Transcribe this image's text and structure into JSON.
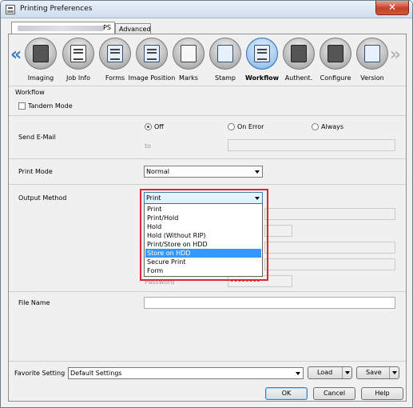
{
  "window": {
    "title": "Printing Preferences",
    "close_symbol": "✕"
  },
  "tabs": {
    "active_label": "PS",
    "inactive_label": "Advanced"
  },
  "iconbar": {
    "items": [
      {
        "label": "Imaging",
        "icon": "imaging-icon"
      },
      {
        "label": "Job Info",
        "icon": "job-info-icon"
      },
      {
        "label": "Forms",
        "icon": "forms-icon"
      },
      {
        "label": "Image Position",
        "icon": "image-position-icon"
      },
      {
        "label": "Marks",
        "icon": "marks-icon"
      },
      {
        "label": "Stamp",
        "icon": "stamp-icon"
      },
      {
        "label": "Workflow",
        "icon": "workflow-icon",
        "active": true
      },
      {
        "label": "Authent.",
        "icon": "authentication-icon"
      },
      {
        "label": "Configure",
        "icon": "configure-icon"
      },
      {
        "label": "Version",
        "icon": "version-icon"
      }
    ],
    "left_arrow": "«",
    "right_arrow": "»"
  },
  "workflow": {
    "section_label": "Workflow",
    "tandem_mode_label": "Tandem Mode",
    "send_email": {
      "label": "Send E-Mail",
      "options": [
        "Off",
        "On Error",
        "Always"
      ],
      "selected": "Off",
      "to_label": "to"
    },
    "print_mode": {
      "label": "Print Mode",
      "value": "Normal"
    },
    "output_method": {
      "label": "Output Method",
      "value": "Print",
      "options": [
        "Print",
        "Print/Hold",
        "Hold",
        "Hold (Without RIP)",
        "Print/Store on HDD",
        "Store on HDD",
        "Secure Print",
        "Form"
      ],
      "highlighted": "Store on HDD",
      "password_label": "Password",
      "password_value": "••••••••"
    },
    "file_name": {
      "label": "File Name",
      "value": ""
    }
  },
  "footer": {
    "favorite_label": "Favorite Setting",
    "favorite_value": "Default Settings",
    "load_label": "Load",
    "save_label": "Save",
    "ok_label": "OK",
    "cancel_label": "Cancel",
    "help_label": "Help"
  },
  "colors": {
    "highlight_border": "#e0262e",
    "selection": "#3399ff",
    "active_icon": "#4f8fd0"
  }
}
